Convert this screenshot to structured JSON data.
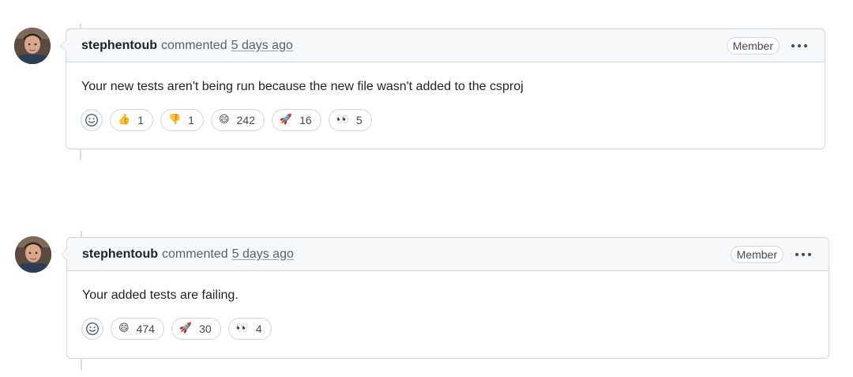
{
  "comments": [
    {
      "author": "stephentoub",
      "action": "commented",
      "timestamp": "5 days ago",
      "role": "Member",
      "body": "Your new tests aren't being run because the new file wasn't added to the csproj",
      "reactions": [
        {
          "emoji": "👍",
          "icon": "thumbs-up-icon",
          "count": "1"
        },
        {
          "emoji": "👎",
          "icon": "thumbs-down-icon",
          "count": "1"
        },
        {
          "emoji": "😄",
          "icon": "laugh-icon",
          "count": "242"
        },
        {
          "emoji": "🚀",
          "icon": "rocket-icon",
          "count": "16"
        },
        {
          "emoji": "👀",
          "icon": "eyes-icon",
          "count": "5"
        }
      ]
    },
    {
      "author": "stephentoub",
      "action": "commented",
      "timestamp": "5 days ago",
      "role": "Member",
      "body": "Your added tests are failing.",
      "reactions": [
        {
          "emoji": "😄",
          "icon": "laugh-icon",
          "count": "474"
        },
        {
          "emoji": "🚀",
          "icon": "rocket-icon",
          "count": "30"
        },
        {
          "emoji": "👀",
          "icon": "eyes-icon",
          "count": "4"
        }
      ]
    }
  ],
  "colors": {
    "border": "#d0d7de",
    "header_bg": "#f6f8fa",
    "text": "#1f2328",
    "muted": "#59636e"
  }
}
